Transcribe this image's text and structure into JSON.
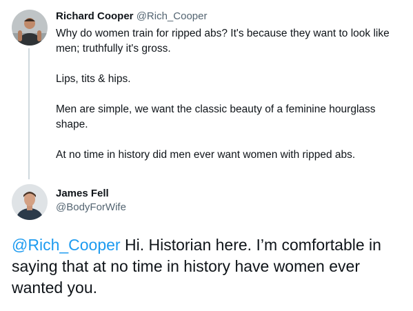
{
  "original_tweet": {
    "author": {
      "display_name": "Richard Cooper",
      "handle": "@Rich_Cooper"
    },
    "paragraphs": [
      "Why do women train for ripped abs?  It's because they want to look like men; truthfully it's gross.",
      "Lips, tits & hips.",
      "Men are simple, we want the classic beauty of a feminine hourglass shape.",
      "At no time in history did men ever want women with ripped abs."
    ]
  },
  "reply_tweet": {
    "author": {
      "display_name": "James Fell",
      "handle": "@BodyForWife"
    },
    "mention": "@Rich_Cooper",
    "text": " Hi. Historian here. I’m comfortable in saying that at no time in history have women ever wanted you."
  },
  "colors": {
    "text": "#0f1419",
    "secondary": "#536471",
    "link": "#1d9bf0",
    "thread_line": "#cfd9de"
  },
  "icons": {
    "avatar_1": "user-avatar-icon",
    "avatar_2": "user-avatar-icon"
  }
}
